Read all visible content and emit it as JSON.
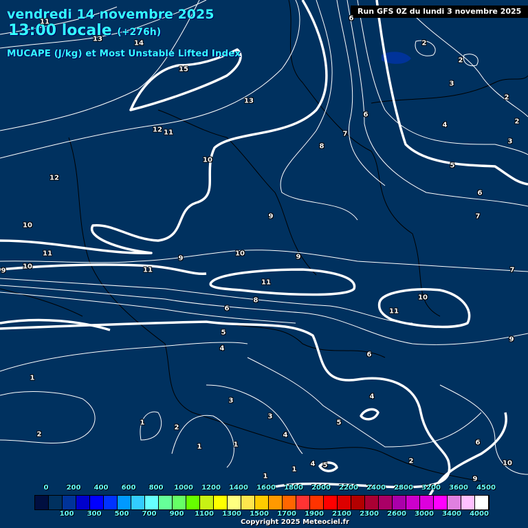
{
  "header": {
    "date": "vendredi 14 novembre 2025",
    "time": "13:00 locale",
    "lead": "(+276h)",
    "parameter": "MUCAPE (J/kg) et Most Unstable Lifted Index",
    "run": "Run GFS 0Z du lundi 3 novembre 2025"
  },
  "contour_labels": [
    "11",
    "13",
    "14",
    "15",
    "13",
    "12",
    "11",
    "10",
    "12",
    "8",
    "7",
    "6",
    "6",
    "2",
    "2",
    "3",
    "2",
    "4",
    "2",
    "3",
    "5",
    "6",
    "7",
    "9",
    "10",
    "11",
    "10",
    "9",
    "9",
    "11",
    "10",
    "9",
    "11",
    "8",
    "6",
    "10",
    "11",
    "7",
    "5",
    "4",
    "6",
    "9",
    "1",
    "4",
    "3",
    "3",
    "5",
    "4",
    "1",
    "2",
    "2",
    "1",
    "1",
    "6",
    "2",
    "4",
    "5",
    "1",
    "1",
    "9",
    "10"
  ],
  "legend": {
    "colors": [
      "#000f40",
      "#00315f",
      "#003399",
      "#0000cc",
      "#0000ff",
      "#0033ff",
      "#0099ff",
      "#33ccff",
      "#66ffff",
      "#66ff99",
      "#66ff66",
      "#66ff00",
      "#c8f214",
      "#ffff00",
      "#ffff80",
      "#ffe64d",
      "#ffcc00",
      "#ff9900",
      "#ff6600",
      "#ff3333",
      "#ff3300",
      "#ff0000",
      "#dd0000",
      "#b30000",
      "#aa0033",
      "#aa0066",
      "#aa00aa",
      "#cc00cc",
      "#dd00dd",
      "#ff00ff",
      "#e080e0",
      "#ffc0ff",
      "#ffffff"
    ],
    "top_labels": [
      "0",
      "200",
      "400",
      "600",
      "800",
      "1000",
      "1200",
      "1400",
      "1600",
      "1800",
      "2000",
      "2200",
      "2400",
      "2800",
      "3200",
      "3600",
      "4500"
    ],
    "bottom_labels": [
      "100",
      "300",
      "500",
      "700",
      "900",
      "1100",
      "1300",
      "1500",
      "1700",
      "1900",
      "2100",
      "2300",
      "2600",
      "3000",
      "3400",
      "4000"
    ]
  },
  "copyright": "Copyright 2025 Meteociel.fr"
}
